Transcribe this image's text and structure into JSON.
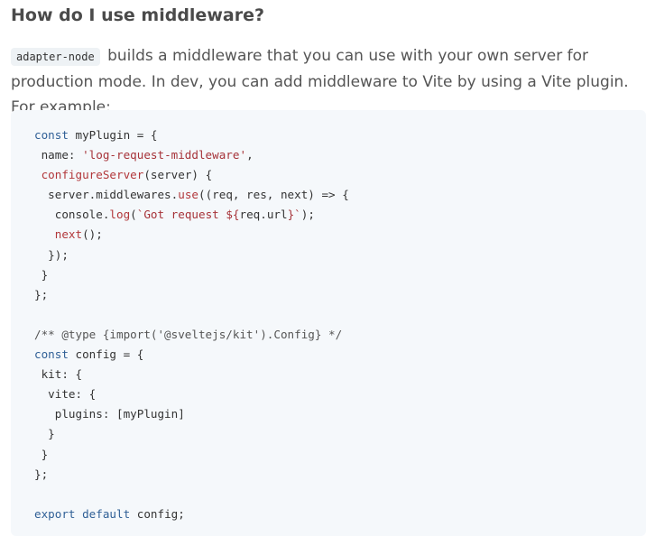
{
  "heading": "How do I use middleware?",
  "intro": {
    "inline_code": "adapter-node",
    "text": "builds a middleware that you can use with your own server for production mode. In dev, you can add middleware to Vite by using a Vite plugin. For example:"
  },
  "code": {
    "lines": [
      [
        {
          "t": "kw",
          "v": "const"
        },
        {
          "t": "plain",
          "v": " myPlugin = {"
        }
      ],
      [
        {
          "t": "plain",
          "v": " name: "
        },
        {
          "t": "str",
          "v": "'log-request-middleware'"
        },
        {
          "t": "plain",
          "v": ","
        }
      ],
      [
        {
          "t": "plain",
          "v": " "
        },
        {
          "t": "fn",
          "v": "configureServer"
        },
        {
          "t": "plain",
          "v": "(server) {"
        }
      ],
      [
        {
          "t": "plain",
          "v": "  server.middlewares."
        },
        {
          "t": "fn",
          "v": "use"
        },
        {
          "t": "plain",
          "v": "((req, res, next) => {"
        }
      ],
      [
        {
          "t": "plain",
          "v": "   console."
        },
        {
          "t": "fn",
          "v": "log"
        },
        {
          "t": "plain",
          "v": "("
        },
        {
          "t": "str",
          "v": "`Got request ${"
        },
        {
          "t": "plain",
          "v": "req.url"
        },
        {
          "t": "str",
          "v": "}`"
        },
        {
          "t": "plain",
          "v": ");"
        }
      ],
      [
        {
          "t": "plain",
          "v": "   "
        },
        {
          "t": "fn",
          "v": "next"
        },
        {
          "t": "plain",
          "v": "();"
        }
      ],
      [
        {
          "t": "plain",
          "v": "  });"
        }
      ],
      [
        {
          "t": "plain",
          "v": " }"
        }
      ],
      [
        {
          "t": "plain",
          "v": "};"
        }
      ],
      [],
      [
        {
          "t": "cm",
          "v": "/** @type {import('@sveltejs/kit').Config} */"
        }
      ],
      [
        {
          "t": "kw",
          "v": "const"
        },
        {
          "t": "plain",
          "v": " config = {"
        }
      ],
      [
        {
          "t": "plain",
          "v": " kit: {"
        }
      ],
      [
        {
          "t": "plain",
          "v": "  vite: {"
        }
      ],
      [
        {
          "t": "plain",
          "v": "   plugins: [myPlugin]"
        }
      ],
      [
        {
          "t": "plain",
          "v": "  }"
        }
      ],
      [
        {
          "t": "plain",
          "v": " }"
        }
      ],
      [
        {
          "t": "plain",
          "v": "};"
        }
      ],
      [],
      [
        {
          "t": "kw",
          "v": "export"
        },
        {
          "t": "plain",
          "v": " "
        },
        {
          "t": "kw",
          "v": "default"
        },
        {
          "t": "plain",
          "v": " config;"
        }
      ]
    ]
  }
}
